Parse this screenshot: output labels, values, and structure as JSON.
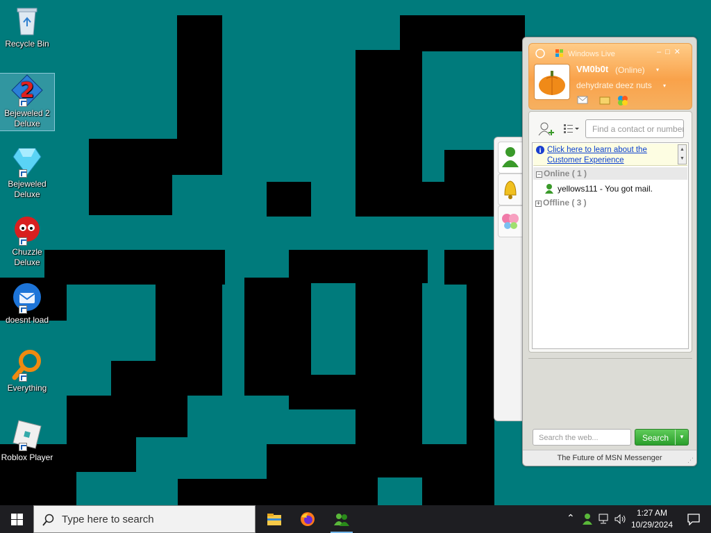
{
  "desktop": {
    "icons": [
      {
        "label": "Recycle Bin",
        "icon": "recycle-bin-icon"
      },
      {
        "label": "Bejeweled 2 Deluxe",
        "icon": "bejeweled-2-icon"
      },
      {
        "label": "Bejeweled Deluxe",
        "icon": "bejeweled-icon"
      },
      {
        "label": "Chuzzle Deluxe",
        "icon": "chuzzle-icon"
      },
      {
        "label": "doesnt load",
        "icon": "thunderbird-icon"
      },
      {
        "label": "Everything",
        "icon": "everything-search-icon"
      },
      {
        "label": "Roblox Player",
        "icon": "roblox-icon"
      }
    ]
  },
  "messenger": {
    "title": "Windows Live",
    "user": {
      "name": "VM0b0t",
      "status": "(Online)",
      "personal_message": "dehydrate deez nuts"
    },
    "find_placeholder": "Find a contact or number...",
    "banner_link": "Click here to learn about the Customer Experience",
    "groups": {
      "online": {
        "label": "Online",
        "count": "( 1 )"
      },
      "offline": {
        "label": "Offline",
        "count": "( 3 )"
      }
    },
    "contacts": [
      {
        "name": "yellows111 - You got mail.",
        "status": "online"
      }
    ],
    "search_placeholder": "Search the web...",
    "search_button": "Search",
    "footer": "The Future of MSN Messenger"
  },
  "taskbar": {
    "search_placeholder": "Type here to search",
    "apps": [
      "file-explorer-icon",
      "firefox-icon",
      "messenger-icon"
    ],
    "clock": {
      "time": "1:27 AM",
      "date": "10/29/2024"
    }
  },
  "colors": {
    "desktop_bg": "#007b7c",
    "wallpaper_blocks": "#000000",
    "msn_header": "#f9a24a",
    "search_button": "#2a9e2a"
  }
}
